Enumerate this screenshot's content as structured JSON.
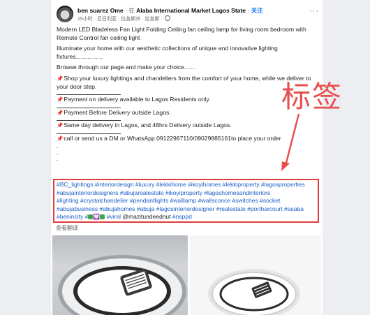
{
  "post": {
    "author": "ben suarez Ome",
    "separator": "·",
    "location_prefix": "在",
    "location": "Alaba International Market Lagos State",
    "follow": "关注",
    "meta": "15小时 · 尼日利亚 · 拉各斯州 · 拉各斯 ·",
    "more": "···",
    "lines": {
      "l1": "Modern LED Bladeless Fan Light Folding Ceiling fan ceiling lamp for living room bedroom with Remote Control  fan ceiling light",
      "l2": "Illuminate your home with our aesthetic collections of unique and innovative lighting fixtures................",
      "l3": "Browse through our page and make your choice.......",
      "l4": "Shop your luxury lightings and chandeliers from the comfort of your home, while we deliver to your door step.",
      "l5": "Payment on delivery available to Lagos Residents only.",
      "l6": "Payment Before Delivery outside Lagos.",
      "l7": "Same day delivery in Lagos, and 48hrs Delivery outside Lagos.",
      "l8": "call or send us a DM or WhatsApp 09122987110/09029885161to place your order",
      "dot": "."
    },
    "hashtag_lines": {
      "h1": "#BC_lightings #interiordesign #luxury #lekkihome #ikoyihomes #lekkiproperty #lagosproperties",
      "h2": "#abujainteriordesigners #abujarealestate #ikoyiproperty #lagoshomesandinteriors",
      "h3": "#lighting #crystalchandelier #pendantlights #walllamp #wallsconce #switches #socket",
      "h4": "#abujabusiness #abujahomes #abuja #lagosinteriordesigner #realestate #portharcourt #asaba",
      "h5a": "#benincity #",
      "h5b": "#viral",
      "h5c": "@mazitundeednut",
      "h5d": "#nsppd"
    },
    "translate": "查看翻译"
  },
  "annotation": {
    "label": "标签",
    "color": "#e94e4e"
  },
  "icons": {
    "pin": "pushpin-icon",
    "globe": "globe-icon"
  }
}
